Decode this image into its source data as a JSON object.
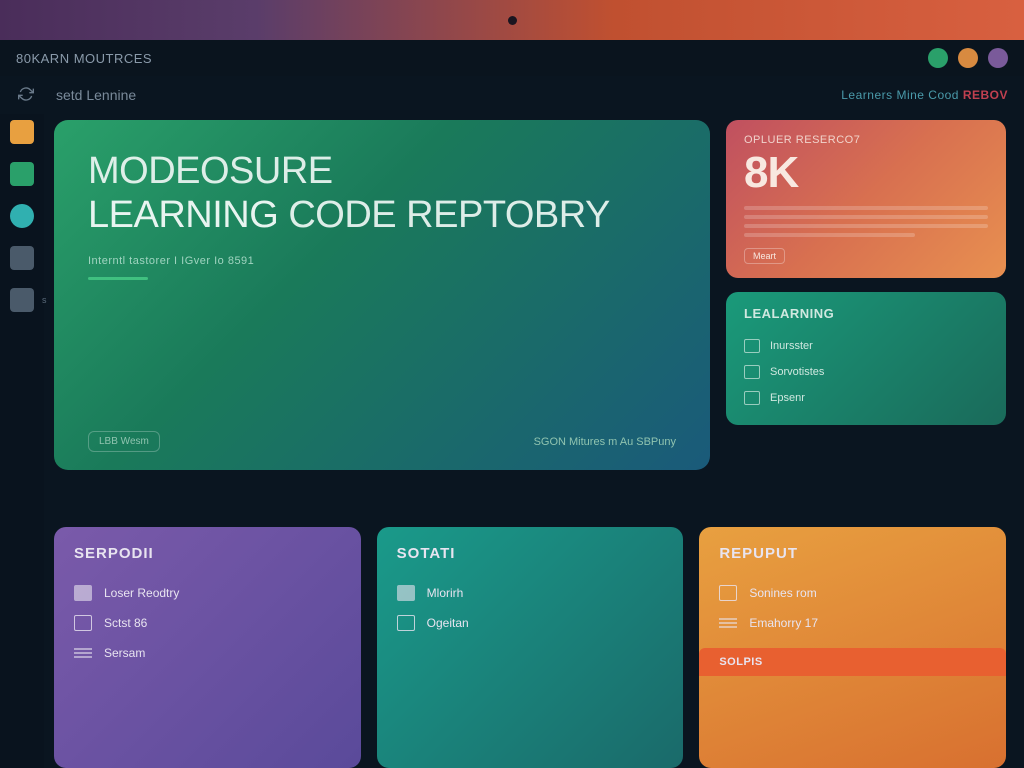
{
  "header": {
    "title": "80Karn Moutrces"
  },
  "sub_header": {
    "left": "setd Lennine",
    "right_prefix": "Learners Mine Cood ",
    "right_accent": "REBOV"
  },
  "sidebar": {
    "items": [
      {
        "color": "side-orange",
        "label": ""
      },
      {
        "color": "side-green",
        "label": ""
      },
      {
        "color": "side-cyan",
        "label": ""
      },
      {
        "color": "side-grey",
        "label": ""
      },
      {
        "color": "side-grey",
        "label": "s"
      }
    ]
  },
  "hero": {
    "line1": "Modeosure",
    "line2a": "Learning",
    "line2b": " Code Reptobry",
    "sub": "Interntl tastorer I IGver Io 8591",
    "footer_left": "LBB Wesm",
    "footer_right": "SGON Mitures m Au SBPuny"
  },
  "stat": {
    "label": "Opluer Reserco7",
    "value": "8K",
    "chip": "Meart"
  },
  "panel": {
    "title": "Lealarning",
    "rows": [
      "Inursster",
      "Sorvotistes",
      "Epsenr"
    ]
  },
  "cat1": {
    "title": "Serpodii",
    "rows": [
      "Loser Reodtry",
      "Sctst 86",
      "Sersam"
    ]
  },
  "cat2": {
    "title": "Sotati",
    "rows": [
      "Mlorirh",
      "Ogeitan"
    ]
  },
  "cat3": {
    "title": "Repuput",
    "rows": [
      "Sonines rom",
      "Emahorry 17"
    ],
    "sub_chip": "Solpis"
  }
}
